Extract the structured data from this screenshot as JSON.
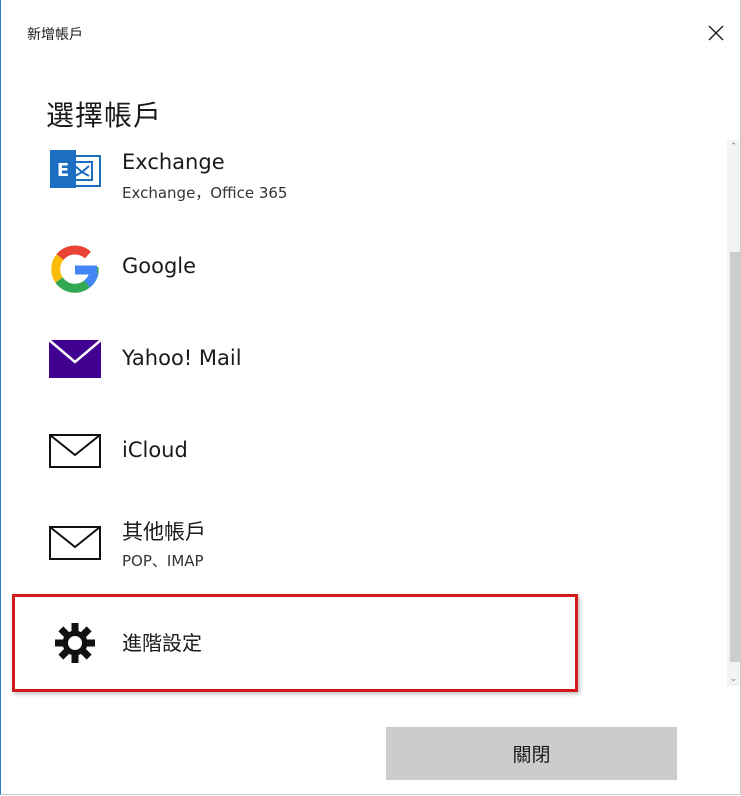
{
  "window": {
    "title": "新增帳戶"
  },
  "heading": "選擇帳戶",
  "accounts": [
    {
      "label": "Exchange",
      "sub": "Exchange，Office 365",
      "icon": "exchange-icon"
    },
    {
      "label": "Google",
      "icon": "google-icon"
    },
    {
      "label": "Yahoo! Mail",
      "icon": "yahoo-mail-icon"
    },
    {
      "label": "iCloud",
      "icon": "envelope-icon"
    },
    {
      "label": "其他帳戶",
      "sub": "POP、IMAP",
      "icon": "envelope-icon"
    },
    {
      "label": "進階設定",
      "icon": "gear-icon"
    }
  ],
  "buttons": {
    "close_label": "關閉"
  },
  "colors": {
    "accent": "#2b7cd3",
    "highlight": "#d11a1a",
    "exchange": "#1b6ec2",
    "yahoo": "#400090",
    "button_bg": "#cccccc"
  }
}
